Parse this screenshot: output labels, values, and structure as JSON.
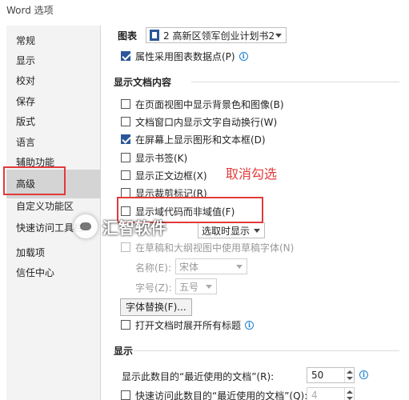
{
  "window": {
    "title": "Word 选项"
  },
  "sidebar": {
    "items": [
      {
        "label": "常规"
      },
      {
        "label": "显示"
      },
      {
        "label": "校对"
      },
      {
        "label": "保存"
      },
      {
        "label": "版式"
      },
      {
        "label": "语言"
      },
      {
        "label": "辅助功能"
      },
      {
        "label": "高级"
      },
      {
        "label": "自定义功能区"
      },
      {
        "label": "快速访问工具栏"
      },
      {
        "label": "加载项"
      },
      {
        "label": "信任中心"
      }
    ],
    "selected": "高级"
  },
  "chart_section": {
    "label": "图表",
    "document_select": "2 高新区领军创业计划书2",
    "use_chart_data_points": {
      "label": "属性采用图表数据点(P)",
      "checked": true
    }
  },
  "doc_content": {
    "title": "显示文档内容",
    "options": [
      {
        "label": "在页面视图中显示背景色和图像(B)",
        "checked": false
      },
      {
        "label": "文档窗口内显示文字自动换行(W)",
        "checked": false
      },
      {
        "label": "在屏幕上显示图形和文本框(D)",
        "checked": true
      },
      {
        "label": "显示书签(K)",
        "checked": false
      },
      {
        "label": "显示正文边框(X)",
        "checked": false
      },
      {
        "label": "显示裁剪标记(R)",
        "checked": false
      },
      {
        "label": "显示域代码而非域值(F)",
        "checked": false
      }
    ],
    "field_shading_select": "选取时显示",
    "draft_font": {
      "label": "在草稿和大纲视图中使用草稿字体(N)",
      "checked": false
    },
    "font_name": {
      "label": "名称(E):",
      "value": "宋体"
    },
    "font_size": {
      "label": "字号(Z):",
      "value": "五号"
    },
    "font_substitution_button": "字体替换(F)...",
    "expand_headings": {
      "label": "打开文档时展开所有标题",
      "checked": false
    }
  },
  "display_section": {
    "title": "显示",
    "recent_docs": {
      "label": "显示此数目的“最近使用的文档”(R):",
      "value": "50"
    },
    "quick_access": {
      "label": "快速访问此数目的“最近使用的文档”(Q):",
      "value": "4",
      "checked": false
    }
  },
  "annotation": {
    "text": "取消勾选",
    "color": "#e23a3a"
  },
  "watermark": {
    "text": "汇智软件"
  },
  "colors": {
    "accent": "#2b579a",
    "selected_nav": "#d4d4d4",
    "annotation": "#e23a3a",
    "info": "#1e7fce"
  }
}
